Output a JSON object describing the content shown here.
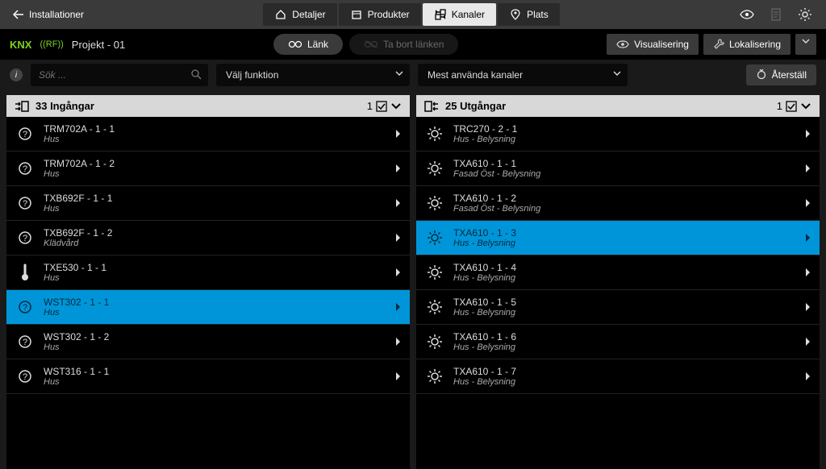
{
  "topnav": {
    "back": "Installationer",
    "tabs": [
      {
        "label": "Detaljer"
      },
      {
        "label": "Produkter"
      },
      {
        "label": "Kanaler",
        "active": true
      },
      {
        "label": "Plats"
      }
    ]
  },
  "bar2": {
    "knx": "KNX",
    "rf": "((RF))",
    "project": "Projekt - 01",
    "link_label": "Länk",
    "unlink_label": "Ta bort länken",
    "viz_label": "Visualisering",
    "loc_label": "Lokalisering"
  },
  "bar3": {
    "search_placeholder": "Sök ...",
    "dd_function": "Välj funktion",
    "dd_used": "Mest använda kanaler",
    "reset": "Återställ"
  },
  "inputs": {
    "title": "33 Ingångar",
    "count": "1",
    "rows": [
      {
        "t": "TRM702A - 1 - 1",
        "s": "Hus",
        "icon": "q"
      },
      {
        "t": "TRM702A - 1 - 2",
        "s": "Hus",
        "icon": "q"
      },
      {
        "t": "TXB692F - 1 - 1",
        "s": "Hus",
        "icon": "q"
      },
      {
        "t": "TXB692F - 1 - 2",
        "s": "Klädvård",
        "icon": "q"
      },
      {
        "t": "TXE530 - 1 - 1",
        "s": "Hus",
        "icon": "temp"
      },
      {
        "t": "WST302 - 1 - 1",
        "s": "Hus",
        "icon": "q",
        "sel": true
      },
      {
        "t": "WST302 - 1 - 2",
        "s": "Hus",
        "icon": "q"
      },
      {
        "t": "WST316 - 1 - 1",
        "s": "Hus",
        "icon": "q"
      }
    ]
  },
  "outputs": {
    "title": "25 Utgångar",
    "count": "1",
    "rows": [
      {
        "t": "TRC270 - 2 - 1",
        "s": "Hus - Belysning",
        "icon": "light"
      },
      {
        "t": "TXA610 - 1 - 1",
        "s": "Fasad Öst - Belysning",
        "icon": "light"
      },
      {
        "t": "TXA610 - 1 - 2",
        "s": "Fasad Öst - Belysning",
        "icon": "light"
      },
      {
        "t": "TXA610 - 1 - 3",
        "s": "Hus - Belysning",
        "icon": "light",
        "sel": true
      },
      {
        "t": "TXA610 - 1 - 4",
        "s": "Hus - Belysning",
        "icon": "light"
      },
      {
        "t": "TXA610 - 1 - 5",
        "s": "Hus - Belysning",
        "icon": "light"
      },
      {
        "t": "TXA610 - 1 - 6",
        "s": "Hus - Belysning",
        "icon": "light"
      },
      {
        "t": "TXA610 - 1 - 7",
        "s": "Hus - Belysning",
        "icon": "light"
      }
    ]
  }
}
